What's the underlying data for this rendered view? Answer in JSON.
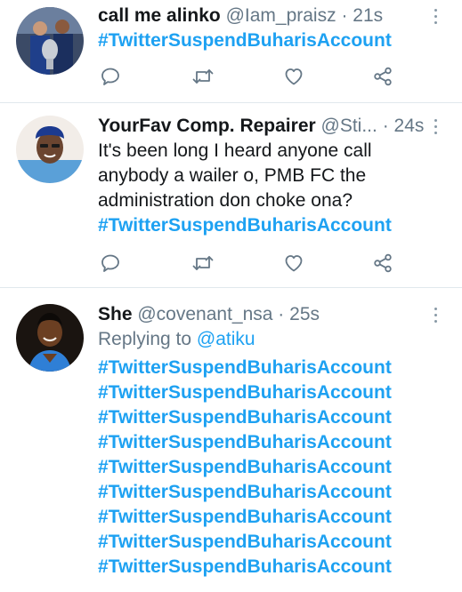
{
  "colors": {
    "link": "#1da1f2",
    "secondary": "#657786",
    "icon": "#657786",
    "divider": "#e1e8ed"
  },
  "tweets": [
    {
      "display_name": "call me alinko",
      "handle": "@Iam_praisz",
      "separator": "·",
      "time": "21s",
      "text_lines": [],
      "hashtags": [
        "#TwitterSuspendBuharisAccount"
      ],
      "actions": [
        "reply-icon",
        "retweet-icon",
        "like-icon",
        "share-icon"
      ]
    },
    {
      "display_name": "YourFav Comp. Repairer",
      "handle": "@Sti...",
      "separator": "·",
      "time": "24s",
      "text_lines": [
        "It's been long I heard anyone call",
        "anybody a wailer o, PMB FC the",
        "administration don choke ona?"
      ],
      "hashtags": [
        "#TwitterSuspendBuharisAccount"
      ],
      "actions": [
        "reply-icon",
        "retweet-icon",
        "like-icon",
        "share-icon"
      ]
    },
    {
      "display_name": "She",
      "handle": "@covenant_nsa",
      "separator": "·",
      "time": "25s",
      "replying_prefix": "Replying to ",
      "replying_to": "@atiku",
      "hashtags": [
        "#TwitterSuspendBuharisAccount",
        "#TwitterSuspendBuharisAccount",
        "#TwitterSuspendBuharisAccount",
        "#TwitterSuspendBuharisAccount",
        "#TwitterSuspendBuharisAccount",
        "#TwitterSuspendBuharisAccount",
        "#TwitterSuspendBuharisAccount",
        "#TwitterSuspendBuharisAccount",
        "#TwitterSuspendBuharisAccount"
      ]
    }
  ]
}
